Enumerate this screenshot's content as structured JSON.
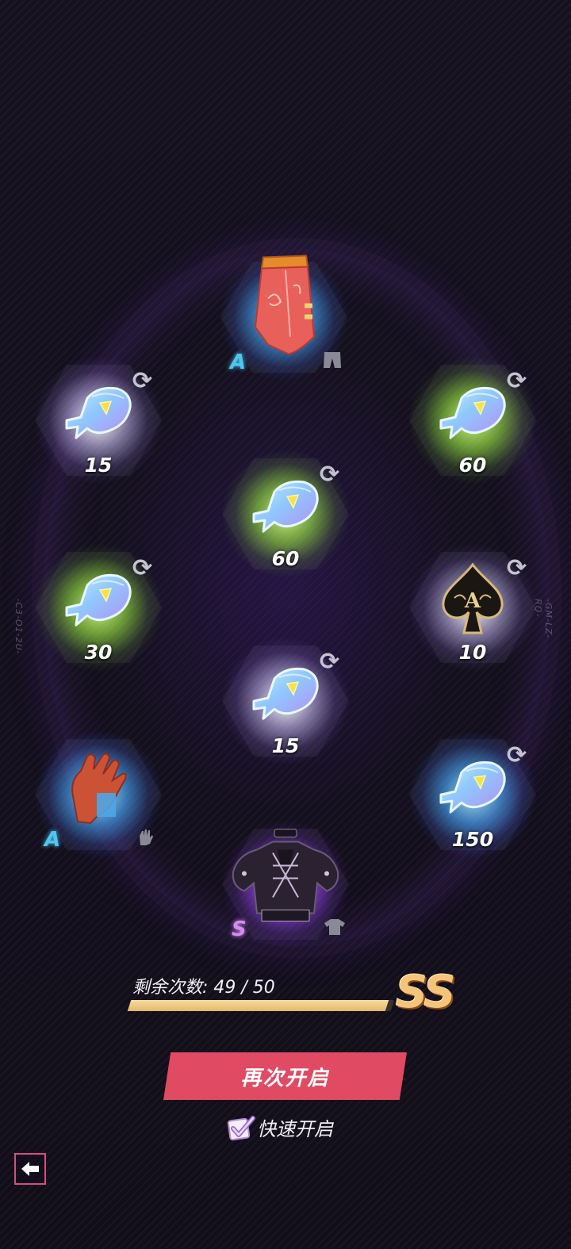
{
  "side_codes": {
    "left": "-C3-O1-2U-",
    "right": "-GM-LZ-RQ-"
  },
  "items": [
    {
      "id": "skirt",
      "kind": "skirt",
      "glow": "blue",
      "rank": "A",
      "rank_color": "#4fc6ef",
      "type_icon": "pants-icon"
    },
    {
      "id": "fish-top-left",
      "kind": "fish",
      "glow": "white",
      "quantity": "15",
      "refreshable": true
    },
    {
      "id": "fish-top-right",
      "kind": "fish",
      "glow": "green",
      "quantity": "60",
      "refreshable": true
    },
    {
      "id": "fish-center-top",
      "kind": "fish",
      "glow": "green",
      "quantity": "60",
      "refreshable": true
    },
    {
      "id": "fish-left",
      "kind": "fish",
      "glow": "green",
      "quantity": "30",
      "refreshable": true
    },
    {
      "id": "ace-card",
      "kind": "ace-spade",
      "glow": "white",
      "quantity": "10",
      "refreshable": true
    },
    {
      "id": "fish-center-bottom",
      "kind": "fish",
      "glow": "white",
      "quantity": "15",
      "refreshable": true
    },
    {
      "id": "glove",
      "kind": "glove",
      "glow": "blue",
      "rank": "A",
      "rank_color": "#4fc6ef",
      "type_icon": "glove-icon"
    },
    {
      "id": "fish-right-bottom",
      "kind": "fish",
      "glow": "blue",
      "quantity": "150",
      "refreshable": true
    },
    {
      "id": "top-outfit",
      "kind": "top",
      "glow": "purple",
      "rank": "S",
      "rank_color": "#d48cf0",
      "type_icon": "shirt-icon"
    }
  ],
  "status": {
    "remaining_label": "剩余次数: 49 / 50",
    "progress_fraction": 0.98,
    "grade": "SS"
  },
  "actions": {
    "open_again": "再次开启",
    "quick_open_label": "快速开启",
    "quick_open_checked": true
  },
  "colors": {
    "button": "#e04a62",
    "progress": "#f0cc8a",
    "grade": "#f3c47a",
    "back_border": "#d84c7e"
  },
  "icons": {
    "refresh": "refresh-icon",
    "back": "back-arrow-icon",
    "check": "checkmark-icon"
  }
}
